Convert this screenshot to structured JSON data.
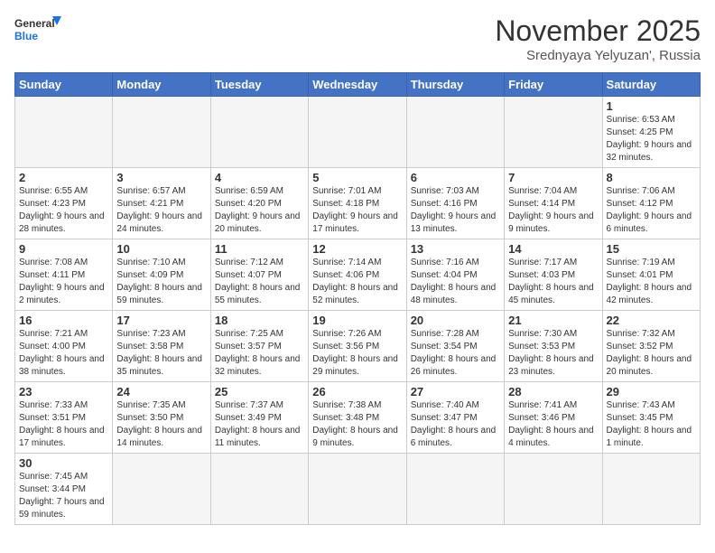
{
  "logo": {
    "line1": "General",
    "line2": "Blue"
  },
  "header": {
    "month": "November 2025",
    "location": "Srednyaya Yelyuzan', Russia"
  },
  "weekdays": [
    "Sunday",
    "Monday",
    "Tuesday",
    "Wednesday",
    "Thursday",
    "Friday",
    "Saturday"
  ],
  "weeks": [
    [
      {
        "day": "",
        "info": "",
        "empty": true
      },
      {
        "day": "",
        "info": "",
        "empty": true
      },
      {
        "day": "",
        "info": "",
        "empty": true
      },
      {
        "day": "",
        "info": "",
        "empty": true
      },
      {
        "day": "",
        "info": "",
        "empty": true
      },
      {
        "day": "",
        "info": "",
        "empty": true
      },
      {
        "day": "1",
        "info": "Sunrise: 6:53 AM\nSunset: 4:25 PM\nDaylight: 9 hours\nand 32 minutes."
      }
    ],
    [
      {
        "day": "2",
        "info": "Sunrise: 6:55 AM\nSunset: 4:23 PM\nDaylight: 9 hours\nand 28 minutes."
      },
      {
        "day": "3",
        "info": "Sunrise: 6:57 AM\nSunset: 4:21 PM\nDaylight: 9 hours\nand 24 minutes."
      },
      {
        "day": "4",
        "info": "Sunrise: 6:59 AM\nSunset: 4:20 PM\nDaylight: 9 hours\nand 20 minutes."
      },
      {
        "day": "5",
        "info": "Sunrise: 7:01 AM\nSunset: 4:18 PM\nDaylight: 9 hours\nand 17 minutes."
      },
      {
        "day": "6",
        "info": "Sunrise: 7:03 AM\nSunset: 4:16 PM\nDaylight: 9 hours\nand 13 minutes."
      },
      {
        "day": "7",
        "info": "Sunrise: 7:04 AM\nSunset: 4:14 PM\nDaylight: 9 hours\nand 9 minutes."
      },
      {
        "day": "8",
        "info": "Sunrise: 7:06 AM\nSunset: 4:12 PM\nDaylight: 9 hours\nand 6 minutes."
      }
    ],
    [
      {
        "day": "9",
        "info": "Sunrise: 7:08 AM\nSunset: 4:11 PM\nDaylight: 9 hours\nand 2 minutes."
      },
      {
        "day": "10",
        "info": "Sunrise: 7:10 AM\nSunset: 4:09 PM\nDaylight: 8 hours\nand 59 minutes."
      },
      {
        "day": "11",
        "info": "Sunrise: 7:12 AM\nSunset: 4:07 PM\nDaylight: 8 hours\nand 55 minutes."
      },
      {
        "day": "12",
        "info": "Sunrise: 7:14 AM\nSunset: 4:06 PM\nDaylight: 8 hours\nand 52 minutes."
      },
      {
        "day": "13",
        "info": "Sunrise: 7:16 AM\nSunset: 4:04 PM\nDaylight: 8 hours\nand 48 minutes."
      },
      {
        "day": "14",
        "info": "Sunrise: 7:17 AM\nSunset: 4:03 PM\nDaylight: 8 hours\nand 45 minutes."
      },
      {
        "day": "15",
        "info": "Sunrise: 7:19 AM\nSunset: 4:01 PM\nDaylight: 8 hours\nand 42 minutes."
      }
    ],
    [
      {
        "day": "16",
        "info": "Sunrise: 7:21 AM\nSunset: 4:00 PM\nDaylight: 8 hours\nand 38 minutes."
      },
      {
        "day": "17",
        "info": "Sunrise: 7:23 AM\nSunset: 3:58 PM\nDaylight: 8 hours\nand 35 minutes."
      },
      {
        "day": "18",
        "info": "Sunrise: 7:25 AM\nSunset: 3:57 PM\nDaylight: 8 hours\nand 32 minutes."
      },
      {
        "day": "19",
        "info": "Sunrise: 7:26 AM\nSunset: 3:56 PM\nDaylight: 8 hours\nand 29 minutes."
      },
      {
        "day": "20",
        "info": "Sunrise: 7:28 AM\nSunset: 3:54 PM\nDaylight: 8 hours\nand 26 minutes."
      },
      {
        "day": "21",
        "info": "Sunrise: 7:30 AM\nSunset: 3:53 PM\nDaylight: 8 hours\nand 23 minutes."
      },
      {
        "day": "22",
        "info": "Sunrise: 7:32 AM\nSunset: 3:52 PM\nDaylight: 8 hours\nand 20 minutes."
      }
    ],
    [
      {
        "day": "23",
        "info": "Sunrise: 7:33 AM\nSunset: 3:51 PM\nDaylight: 8 hours\nand 17 minutes."
      },
      {
        "day": "24",
        "info": "Sunrise: 7:35 AM\nSunset: 3:50 PM\nDaylight: 8 hours\nand 14 minutes."
      },
      {
        "day": "25",
        "info": "Sunrise: 7:37 AM\nSunset: 3:49 PM\nDaylight: 8 hours\nand 11 minutes."
      },
      {
        "day": "26",
        "info": "Sunrise: 7:38 AM\nSunset: 3:48 PM\nDaylight: 8 hours\nand 9 minutes."
      },
      {
        "day": "27",
        "info": "Sunrise: 7:40 AM\nSunset: 3:47 PM\nDaylight: 8 hours\nand 6 minutes."
      },
      {
        "day": "28",
        "info": "Sunrise: 7:41 AM\nSunset: 3:46 PM\nDaylight: 8 hours\nand 4 minutes."
      },
      {
        "day": "29",
        "info": "Sunrise: 7:43 AM\nSunset: 3:45 PM\nDaylight: 8 hours\nand 1 minute."
      }
    ],
    [
      {
        "day": "30",
        "info": "Sunrise: 7:45 AM\nSunset: 3:44 PM\nDaylight: 7 hours\nand 59 minutes.",
        "last": true
      },
      {
        "day": "",
        "info": "",
        "empty": true,
        "last": true
      },
      {
        "day": "",
        "info": "",
        "empty": true,
        "last": true
      },
      {
        "day": "",
        "info": "",
        "empty": true,
        "last": true
      },
      {
        "day": "",
        "info": "",
        "empty": true,
        "last": true
      },
      {
        "day": "",
        "info": "",
        "empty": true,
        "last": true
      },
      {
        "day": "",
        "info": "",
        "empty": true,
        "last": true
      }
    ]
  ]
}
